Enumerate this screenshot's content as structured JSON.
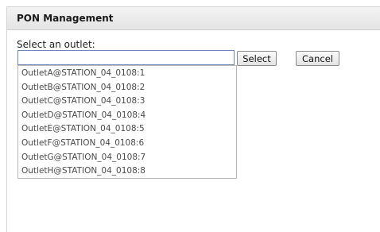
{
  "dialog": {
    "title": "PON Management",
    "prompt": "Select an outlet:",
    "input_value": "",
    "select_label": "Select",
    "cancel_label": "Cancel"
  },
  "dropdown": {
    "items": [
      "OutletA@STATION_04_0108:1",
      "OutletB@STATION_04_0108:2",
      "OutletC@STATION_04_0108:3",
      "OutletD@STATION_04_0108:4",
      "OutletE@STATION_04_0108:5",
      "OutletF@STATION_04_0108:6",
      "OutletG@STATION_04_0108:7",
      "OutletH@STATION_04_0108:8"
    ]
  }
}
